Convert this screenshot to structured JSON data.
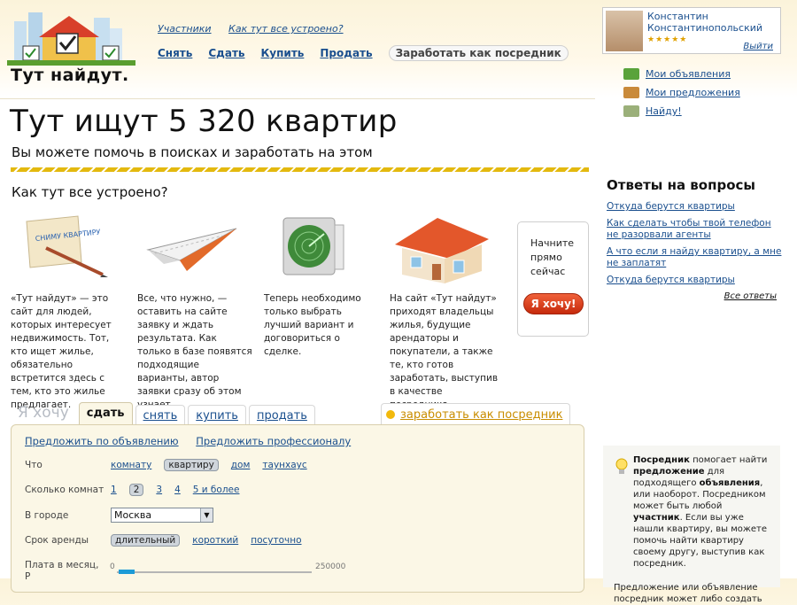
{
  "brand": {
    "logo_text": "Тут найдут."
  },
  "header": {
    "top_links": [
      "Участники",
      "Как тут все устроено?"
    ],
    "nav": [
      "Снять",
      "Сдать",
      "Купить",
      "Продать"
    ],
    "nav_active": "Заработать как посредник"
  },
  "user": {
    "name_line1": "Константин",
    "name_line2": "Константинопольский",
    "rating_stars": "★★★★★",
    "rating": 5,
    "logout": "Выйти"
  },
  "right_menu": [
    {
      "icon": "ads-icon",
      "label": "Мои объявления",
      "color": "#5aa33b"
    },
    {
      "icon": "offers-icon",
      "label": "Мои предложения",
      "color": "#c98a3a"
    },
    {
      "icon": "found-icon",
      "label": "Найду!",
      "color": "#9bb07a"
    }
  ],
  "hero": {
    "title": "Тут ищут 5 320 квартир",
    "subtitle": "Вы можете помочь в поисках и заработать на этом"
  },
  "how": {
    "title": "Как тут все устроено?",
    "steps": [
      "«Тут найдут» — это сайт для людей, которых интересует недвижимость. Тот, кто ищет жилье, обязательно встретится здесь с тем, кто это жилье предлагает.",
      "Все, что нужно, — оставить на сайте заявку и ждать результата. Как только в базе появятся подходящие варианты, автор заявки сразу об этом узнает.",
      "Теперь необходимо только выбрать лучший вариант и договориться о сделке.",
      "На сайт «Тут найдут» приходят владельцы жилья, будущие арендаторы и покупатели, а также те, кто готов заработать, выступив в качестве посредника."
    ],
    "sign_text": "СНИМУ КВАРТИРУ"
  },
  "cta": {
    "text": "Начните прямо сейчас",
    "button": "Я хочу!"
  },
  "faq": {
    "title": "Ответы на вопросы",
    "items": [
      "Откуда берутся квартиры",
      "Как сделать чтобы твой телефон не разорвали агенты",
      "А что если я найду квартиру, а мне не заплатят",
      "Откуда берутся квартиры"
    ],
    "all": "Все ответы"
  },
  "tabs": {
    "hint": "Я хочу",
    "items": [
      "сдать",
      "снять",
      "купить",
      "продать"
    ],
    "active": "сдать",
    "agent": "заработать как посредник"
  },
  "form": {
    "links": [
      "Предложить по объявлению",
      "Предложить профессионалу"
    ],
    "what": {
      "label": "Что",
      "options": [
        "комнату",
        "квартиру",
        "дом",
        "таунхаус"
      ],
      "selected": "квартиру"
    },
    "rooms": {
      "label": "Сколько комнат",
      "options": [
        "1",
        "2",
        "3",
        "4",
        "5 и более"
      ],
      "selected": "2"
    },
    "city": {
      "label": "В городе",
      "value": "Москва"
    },
    "term": {
      "label": "Срок аренды",
      "options": [
        "длительный",
        "короткий",
        "посуточно"
      ],
      "selected": "длительный"
    },
    "price": {
      "label": "Плата в месяц, Р",
      "min": "0",
      "max": "250000"
    }
  },
  "info": {
    "p1_b1": "Посредник",
    "p1_t1": " помогает найти ",
    "p1_b2": "предложение",
    "p1_t2": " для подходящего ",
    "p1_b3": "объявления",
    "p1_t3": ", или наоборот. Посредником может быть любой ",
    "p1_b4": "участник",
    "p1_t4": ". Если вы уже нашли квартиру, вы можете помочь найти квартиру своему другу, выступив как посредник.",
    "p2": "Предложение или объявление посредник может либо создать"
  },
  "colors": {
    "accent": "#1a4f8e",
    "cta": "#d9401b",
    "stripe": "#e3b90f",
    "panel": "#fbf7e6"
  }
}
